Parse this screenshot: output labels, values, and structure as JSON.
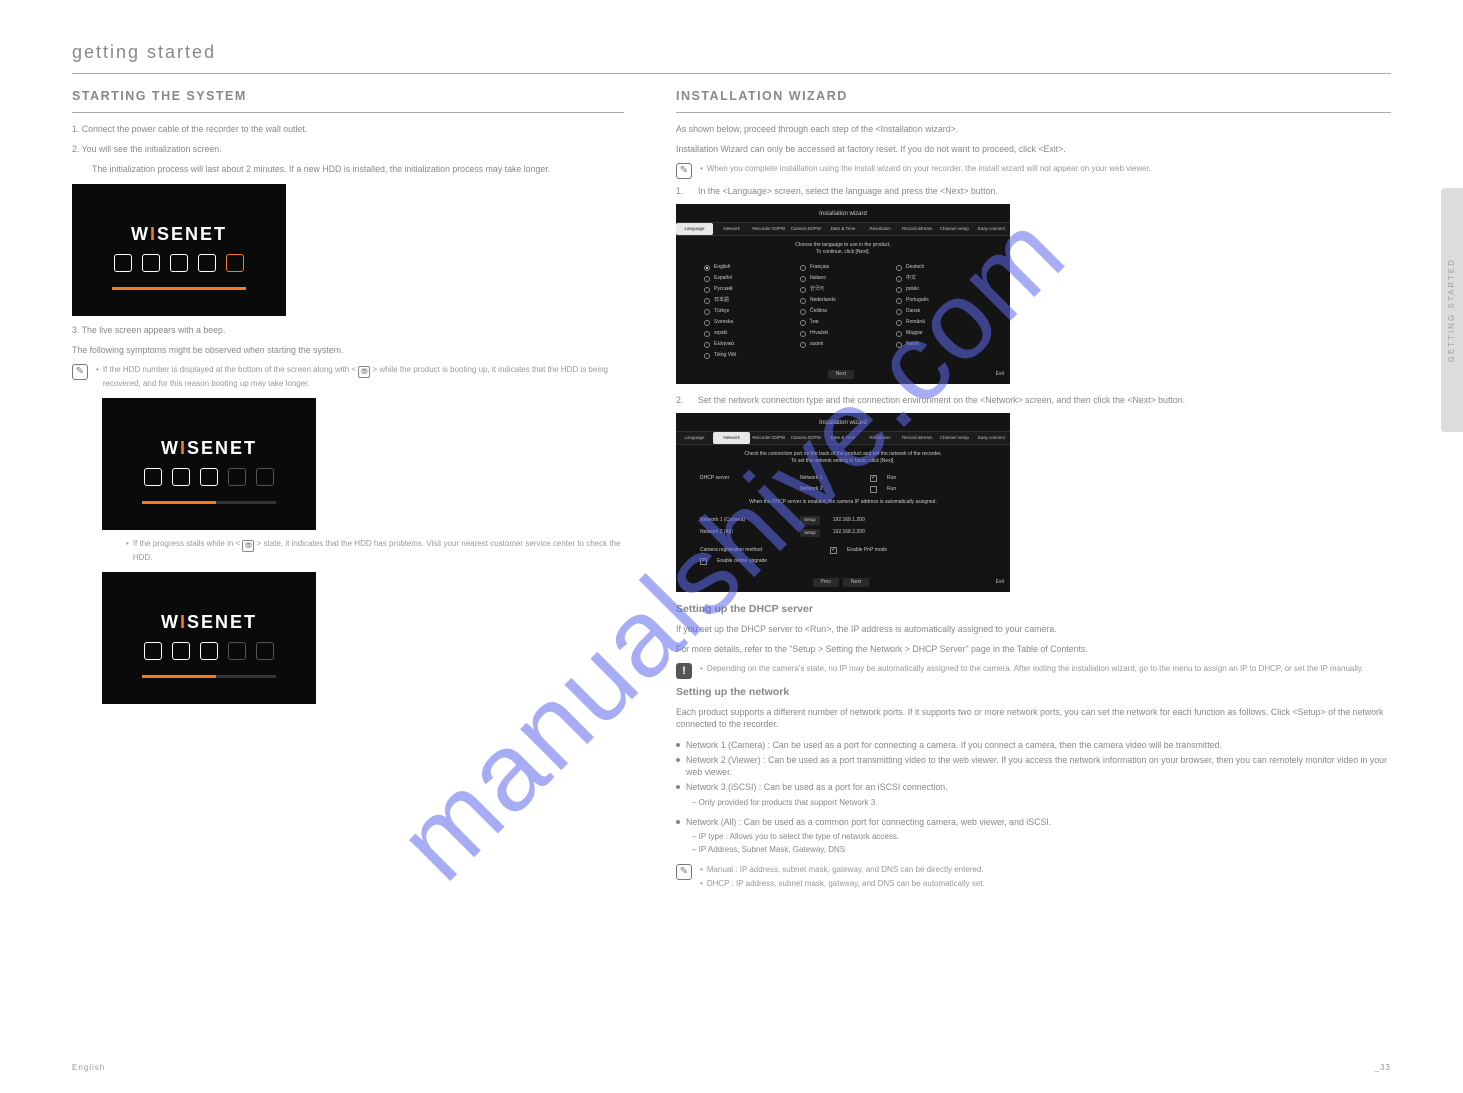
{
  "watermark": "manualshive.com",
  "pageHeader": "getting started",
  "sideTab": "GETTING STARTED",
  "left": {
    "secTitle": "STARTING THE SYSTEM",
    "para1a": "1.    Connect the power cable of the recorder to the wall outlet.",
    "para1b": "2.    You will see the initialization screen.",
    "para1c": "The initialization process will last about 2 minutes. If a new HDD is installed, the initialization process may take longer.",
    "logo": "WISENET",
    "para2a": "3.    The live screen appears with a beep.",
    "para2b": "The following symptoms might be observed when starting the system.",
    "note1_label": "If the HDD number is displayed at the bottom of the screen along with <",
    "note1_tail": "> while the product is booting up, it indicates that the HDD is being recovered, and for this reason booting up may take longer.",
    "note2_label": "If the progress stalls while in <",
    "note2_tail": "> state, it indicates that the HDD has problems. Visit your nearest customer service center to check the HDD."
  },
  "right": {
    "secTitle": "INSTALLATION WIZARD",
    "intro": "As shown below, proceed through each step of the <Installation wizard>.",
    "intro2": "Installation Wizard can only be accessed at factory reset. If you do not want to proceed, click <Exit>.",
    "note1": "When you complete installation using the install wizard on your recorder, the install wizard will not appear on your web viewer.",
    "step1_no": "1.",
    "step1": "In the <Language> screen, select the language and press the <Next> button.",
    "wiz": {
      "title": "Installation wizard",
      "tabs": [
        "Language",
        "Network",
        "Recorder ID/PW",
        "Camera ID/PW",
        "Date & Time",
        "Resolution",
        "Record.istream",
        "Channel setup",
        "Easy connect"
      ],
      "hint_line1": "Choose the language to use in the product.",
      "hint_line2": "To continue, click [Next].",
      "languages": [
        {
          "label": "English",
          "sel": true
        },
        {
          "label": "Français",
          "sel": false
        },
        {
          "label": "Deutsch",
          "sel": false
        },
        {
          "label": "Español",
          "sel": false
        },
        {
          "label": "Italiano",
          "sel": false
        },
        {
          "label": "中文",
          "sel": false
        },
        {
          "label": "Русский",
          "sel": false
        },
        {
          "label": "한국어",
          "sel": false
        },
        {
          "label": "polski",
          "sel": false
        },
        {
          "label": "日本語",
          "sel": false
        },
        {
          "label": "Nederlands",
          "sel": false
        },
        {
          "label": "Português",
          "sel": false
        },
        {
          "label": "Türkçe",
          "sel": false
        },
        {
          "label": "Čeština",
          "sel": false
        },
        {
          "label": "Dansk",
          "sel": false
        },
        {
          "label": "Svenska",
          "sel": false
        },
        {
          "label": "ไทย",
          "sel": false
        },
        {
          "label": "Română",
          "sel": false
        },
        {
          "label": "srpski",
          "sel": false
        },
        {
          "label": "Hrvatski",
          "sel": false
        },
        {
          "label": "Magyar",
          "sel": false
        },
        {
          "label": "Ελληνικά",
          "sel": false
        },
        {
          "label": "suomi",
          "sel": false
        },
        {
          "label": "Norsk",
          "sel": false
        },
        {
          "label": "Tiếng Việt",
          "sel": false
        }
      ],
      "next": "Next",
      "exit": "Exit",
      "prev": "Prev"
    },
    "step2_no": "2.",
    "step2": "Set the network connection type and the connection environment on the <Network> screen, and then click the <Next> button.",
    "wiz2": {
      "title": "Installation wizard",
      "hint1": "Check the connection port on the back of the product and set the network of the recorder.",
      "hint2": "To set the network setting to basic, click [Next].",
      "dhcp_label": "DHCP server",
      "net1": "Network 1",
      "net1_run": "Run",
      "net1_checked": true,
      "net2": "Network 2",
      "net2_run": "Run",
      "net2_checked": false,
      "dhcp_note": "When the DHCP server is enabled, the camera IP address is automatically assigned.",
      "row_a_label": "Network 1 (Camera)",
      "row_a_btn": "Setup",
      "row_a_ip": "192.168.1.200",
      "row_b_label": "Network 2 (All)",
      "row_b_btn": "Setup",
      "row_b_ip": "192.168.2.200",
      "cam_reg_label": "Camera registration method",
      "cam_reg_opt": "Enable PnP mode",
      "cam_reg_checked": true,
      "online_upgrade": "Enable online upgrade",
      "online_upgrade_checked": true
    },
    "dhcp_head": "Setting up the DHCP server",
    "dhcp_body": "If you set up the DHCP server to <Run>, the IP address is automatically assigned to your camera.",
    "dhcp_body2": "For more details, refer to the \"Setup > Setting the Network > DHCP Server\" page in the Table of Contents.",
    "warn1": "Depending on the camera's state, no IP may be automatically assigned to the camera. After exiting the installation wizard, go to the menu to assign an IP to DHCP, or set the IP manually.",
    "net_head": "Setting up the network",
    "net_body": "Each product supports a different number of network ports. If it supports two or more network ports, you can set the network for each function as follows. Click <Setup> of the network connected to the recorder.",
    "bul1": "Network 1 (Camera) : Can be used as a port for connecting a camera. If you connect a camera, then the camera video will be transmitted.",
    "bul2": "Network 2 (Viewer) : Can be used as a port transmitting video to the web viewer. If you access the network information on your browser, then you can remotely monitor video in your web viewer.",
    "bul3": "Network 3 (iSCSI) : Can be used as a port for an iSCSI connection.",
    "bul3_sub": "Only provided for products that support Network 3.",
    "bul4": "Network (All) : Can be used as a common port for connecting camera, web viewer, and iSCSI.",
    "bul4_sub1": "IP type : Allows you to select the type of network access.",
    "bul4_sub2": "IP Address, Subnet Mask, Gateway, DNS",
    "ni_manual": "Manual : IP address, subnet mask, gateway, and DNS can be directly entered.",
    "ni_dhcp": "DHCP : IP address, subnet mask, gateway, and DNS can be automatically set."
  },
  "footer": {
    "left": "English",
    "right": "_33"
  }
}
